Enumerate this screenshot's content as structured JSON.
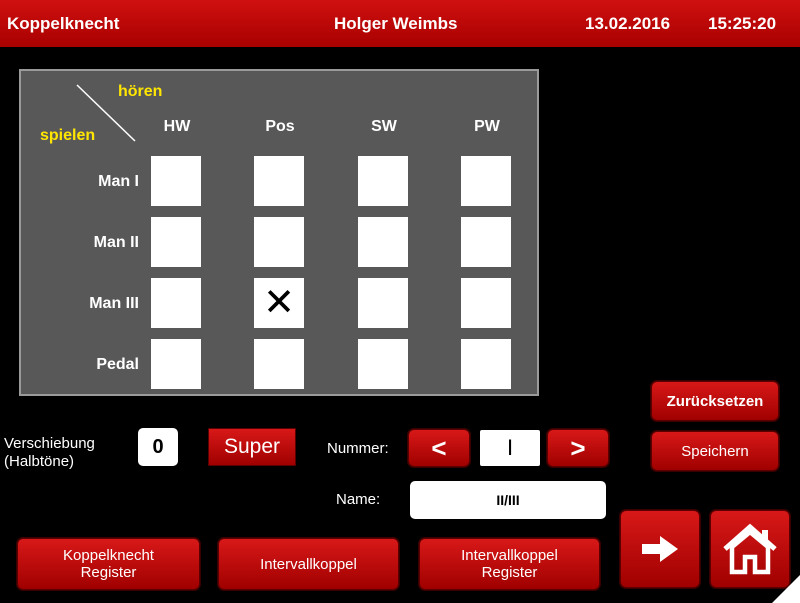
{
  "header": {
    "app_title": "Koppelknecht",
    "user": "Holger Weimbs",
    "date": "13.02.2016",
    "time": "15:25:20"
  },
  "matrix": {
    "label_hear": "hören",
    "label_play": "spielen",
    "columns": [
      "HW",
      "Pos",
      "SW",
      "PW"
    ],
    "rows": [
      "Man I",
      "Man II",
      "Man III",
      "Pedal"
    ],
    "checked": [
      [
        false,
        false,
        false,
        false
      ],
      [
        false,
        false,
        false,
        false
      ],
      [
        false,
        true,
        false,
        false
      ],
      [
        false,
        false,
        false,
        false
      ]
    ],
    "check_mark": "✕"
  },
  "transpose": {
    "label_line1": "Verschiebung",
    "label_line2": "(Halbtöne)",
    "value": "0"
  },
  "super_label": "Super",
  "number": {
    "label": "Nummer:",
    "prev": "<",
    "value": "I",
    "next": ">"
  },
  "name": {
    "label": "Name:",
    "value": "II/III"
  },
  "buttons": {
    "reset": "Zurücksetzen",
    "save": "Speichern",
    "coupler_register_line1": "Koppelknecht",
    "coupler_register_line2": "Register",
    "interval_coupler": "Intervallkoppel",
    "interval_register_line1": "Intervallkoppel",
    "interval_register_line2": "Register",
    "next_icon": "arrow-right-icon",
    "home_icon": "home-icon"
  },
  "colors": {
    "accent_red": "#c00000",
    "panel_gray": "#585858",
    "label_yellow": "#ffe600"
  }
}
